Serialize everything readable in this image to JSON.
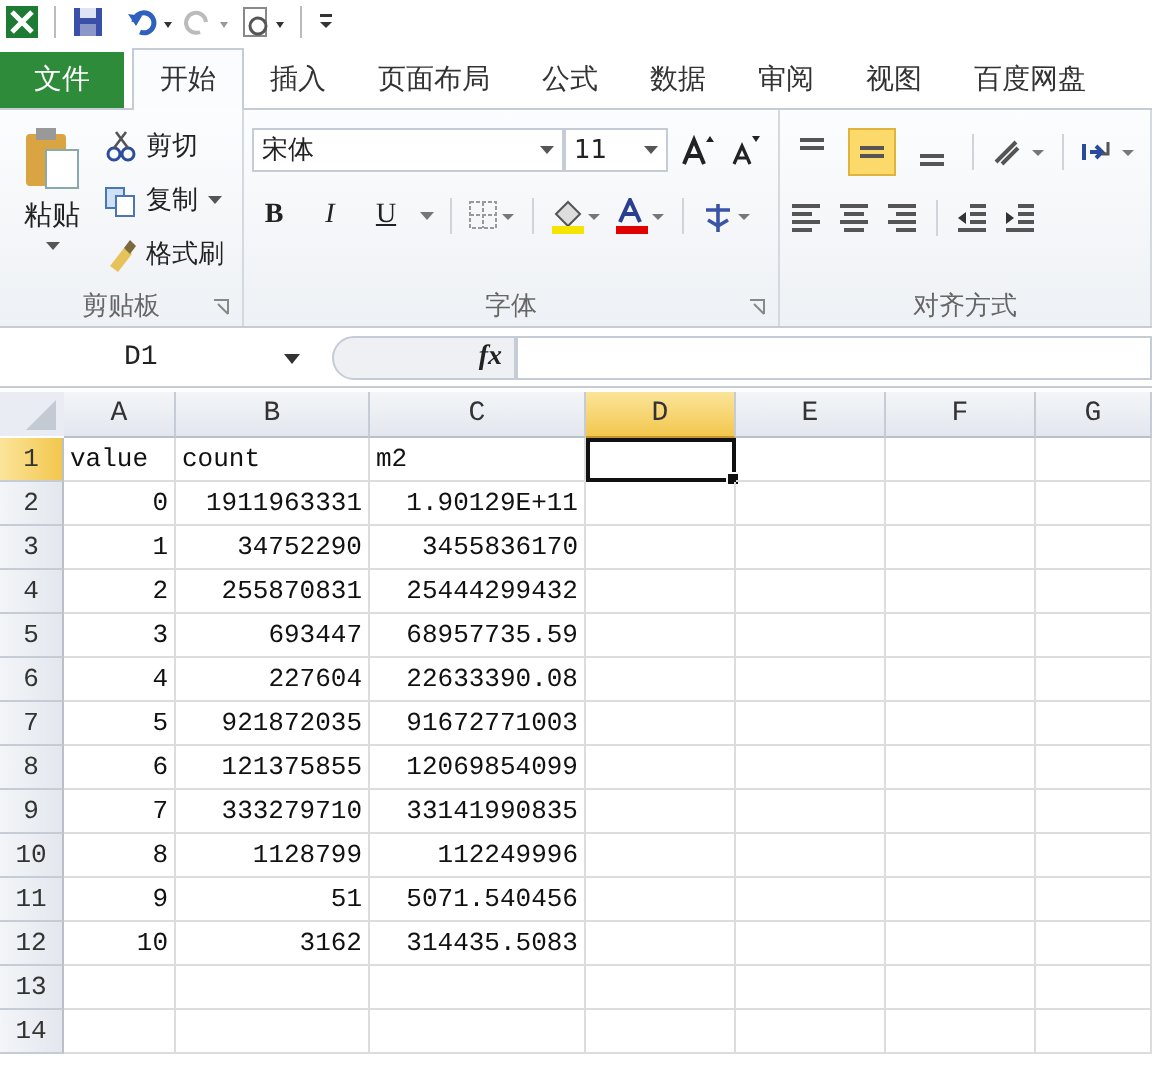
{
  "quick_access": {
    "items": [
      {
        "kind": "app"
      },
      {
        "kind": "save"
      },
      {
        "kind": "undo"
      },
      {
        "kind": "redo"
      },
      {
        "kind": "preview"
      },
      {
        "kind": "customize"
      }
    ]
  },
  "tabs": [
    {
      "label": "文件",
      "kind": "file",
      "selected": false
    },
    {
      "label": "开始",
      "kind": "tab",
      "selected": true
    },
    {
      "label": "插入",
      "kind": "tab",
      "selected": false
    },
    {
      "label": "页面布局",
      "kind": "tab",
      "selected": false
    },
    {
      "label": "公式",
      "kind": "tab",
      "selected": false
    },
    {
      "label": "数据",
      "kind": "tab",
      "selected": false
    },
    {
      "label": "审阅",
      "kind": "tab",
      "selected": false
    },
    {
      "label": "视图",
      "kind": "tab",
      "selected": false
    },
    {
      "label": "百度网盘",
      "kind": "tab",
      "selected": false
    }
  ],
  "ribbon": {
    "clipboard": {
      "paste": "粘贴",
      "cut": "剪切",
      "copy": "复制",
      "format_painter": "格式刷",
      "label": "剪贴板"
    },
    "font": {
      "font_name": "宋体",
      "font_size": "11",
      "bold": "B",
      "italic": "I",
      "underline": "U",
      "label": "字体"
    },
    "alignment": {
      "vertical": [
        {
          "selected": false
        },
        {
          "selected": true
        },
        {
          "selected": false
        }
      ],
      "label": "对齐方式"
    }
  },
  "formula_bar": {
    "name_box": "D1",
    "function_symbol": "fx"
  },
  "sheet": {
    "columns": [
      {
        "label": "A",
        "selected": false
      },
      {
        "label": "B",
        "selected": false
      },
      {
        "label": "C",
        "selected": false
      },
      {
        "label": "D",
        "selected": true
      },
      {
        "label": "E",
        "selected": false
      },
      {
        "label": "F",
        "selected": false
      },
      {
        "label": "G",
        "selected": false
      }
    ],
    "rows": [
      {
        "number": "1",
        "selected": true,
        "kind": "header",
        "cells": [
          "value",
          "count",
          "m2"
        ]
      },
      {
        "number": "2",
        "selected": false,
        "kind": "data",
        "cells": [
          "0",
          "1911963331",
          "1.90129E+11"
        ]
      },
      {
        "number": "3",
        "selected": false,
        "kind": "data",
        "cells": [
          "1",
          "34752290",
          "3455836170"
        ]
      },
      {
        "number": "4",
        "selected": false,
        "kind": "data",
        "cells": [
          "2",
          "255870831",
          "25444299432"
        ]
      },
      {
        "number": "5",
        "selected": false,
        "kind": "data",
        "cells": [
          "3",
          "693447",
          "68957735.59"
        ]
      },
      {
        "number": "6",
        "selected": false,
        "kind": "data",
        "cells": [
          "4",
          "227604",
          "22633390.08"
        ]
      },
      {
        "number": "7",
        "selected": false,
        "kind": "data",
        "cells": [
          "5",
          "921872035",
          "91672771003"
        ]
      },
      {
        "number": "8",
        "selected": false,
        "kind": "data",
        "cells": [
          "6",
          "121375855",
          "12069854099"
        ]
      },
      {
        "number": "9",
        "selected": false,
        "kind": "data",
        "cells": [
          "7",
          "333279710",
          "33141990835"
        ]
      },
      {
        "number": "10",
        "selected": false,
        "kind": "data",
        "cells": [
          "8",
          "1128799",
          "112249996"
        ]
      },
      {
        "number": "11",
        "selected": false,
        "kind": "data",
        "cells": [
          "9",
          "51",
          "5071.540456"
        ]
      },
      {
        "number": "12",
        "selected": false,
        "kind": "data",
        "cells": [
          "10",
          "3162",
          "314435.5083"
        ]
      },
      {
        "number": "13",
        "selected": false,
        "kind": "data",
        "cells": []
      },
      {
        "number": "14",
        "selected": false,
        "kind": "data",
        "cells": []
      }
    ]
  }
}
